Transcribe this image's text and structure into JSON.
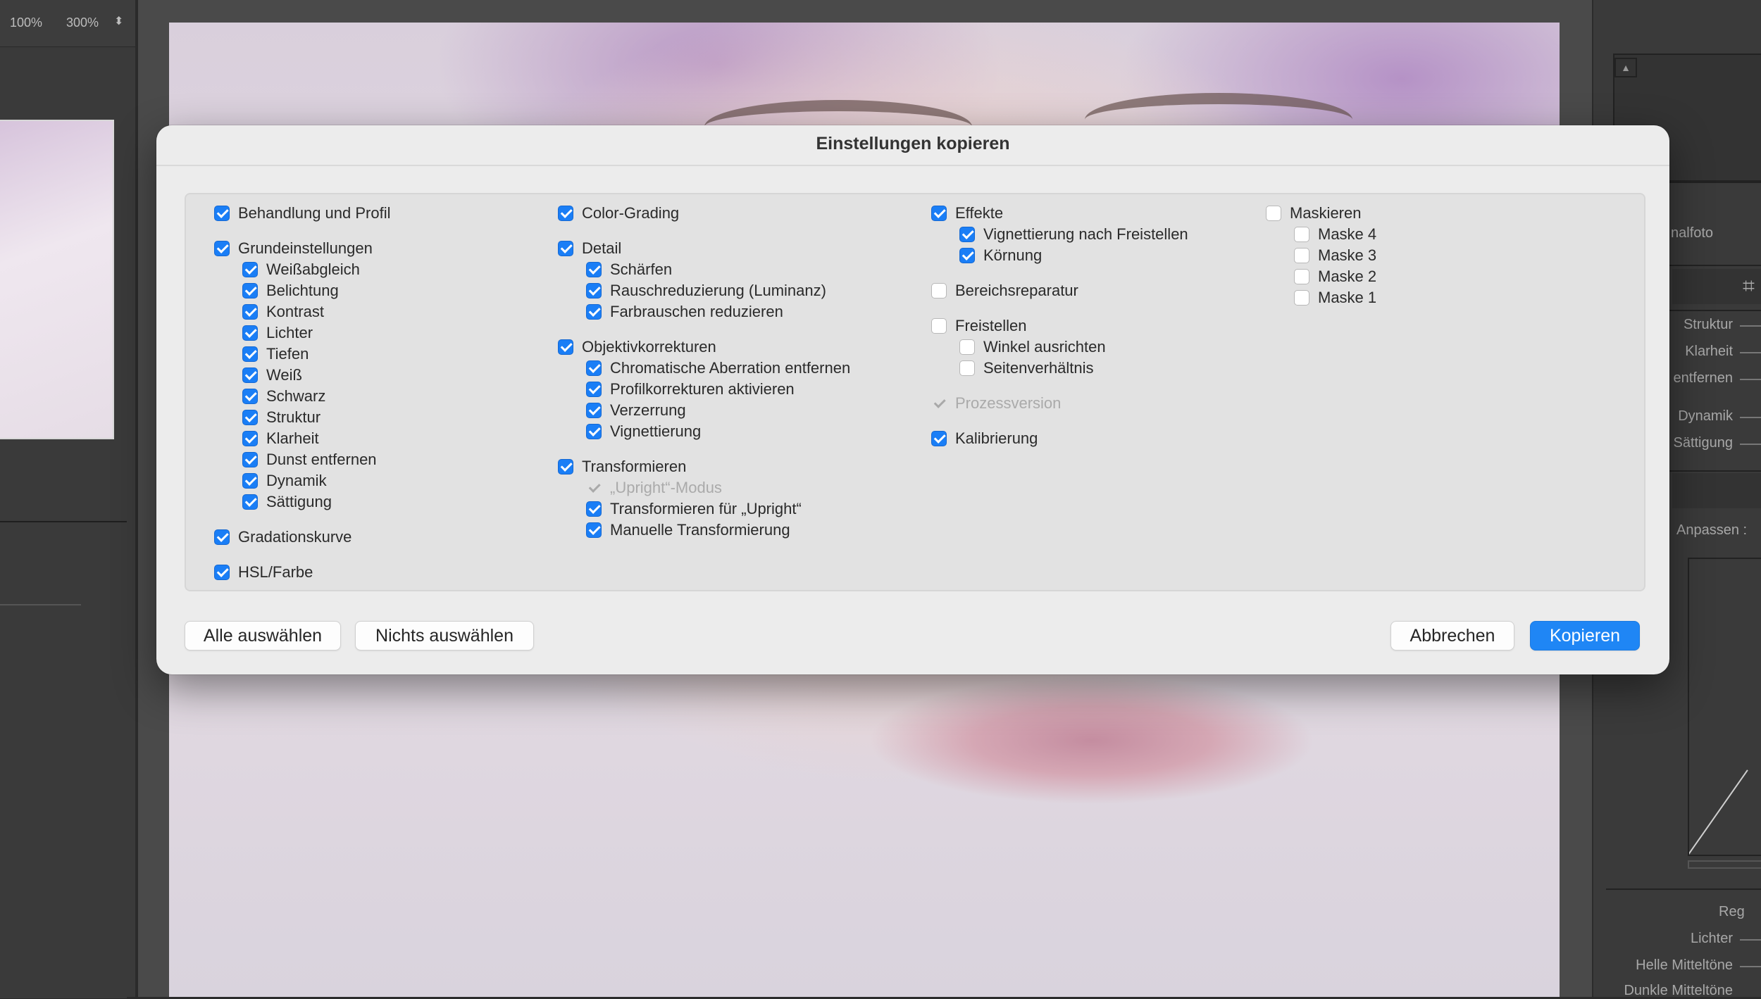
{
  "background": {
    "zoom_options": [
      "100%",
      "300%"
    ],
    "right_panel_labels": {
      "photo_label": "nalfoto",
      "struktur": "Struktur",
      "klarheit": "Klarheit",
      "entfernen": "entfernen",
      "dynamik": "Dynamik",
      "saettigung": "Sättigung",
      "anpassen": "Anpassen :",
      "reg": "Reg",
      "lichter": "Lichter",
      "helle_mitteltoene": "Helle Mitteltöne",
      "dunkle_mitteltoene": "Dunkle Mitteltöne"
    }
  },
  "dialog": {
    "title": "Einstellungen kopieren",
    "columns": [
      {
        "groups": [
          {
            "label": "Behandlung und Profil",
            "state": "checked",
            "children": []
          },
          {
            "label": "Grundeinstellungen",
            "state": "checked",
            "children": [
              {
                "label": "Weißabgleich",
                "state": "checked"
              },
              {
                "label": "Belichtung",
                "state": "checked"
              },
              {
                "label": "Kontrast",
                "state": "checked"
              },
              {
                "label": "Lichter",
                "state": "checked"
              },
              {
                "label": "Tiefen",
                "state": "checked"
              },
              {
                "label": "Weiß",
                "state": "checked"
              },
              {
                "label": "Schwarz",
                "state": "checked"
              },
              {
                "label": "Struktur",
                "state": "checked"
              },
              {
                "label": "Klarheit",
                "state": "checked"
              },
              {
                "label": "Dunst entfernen",
                "state": "checked"
              },
              {
                "label": "Dynamik",
                "state": "checked"
              },
              {
                "label": "Sättigung",
                "state": "checked"
              }
            ]
          },
          {
            "label": "Gradationskurve",
            "state": "checked",
            "children": []
          },
          {
            "label": "HSL/Farbe",
            "state": "checked",
            "children": []
          }
        ]
      },
      {
        "groups": [
          {
            "label": "Color-Grading",
            "state": "checked",
            "children": []
          },
          {
            "label": "Detail",
            "state": "checked",
            "children": [
              {
                "label": "Schärfen",
                "state": "checked"
              },
              {
                "label": "Rauschreduzierung (Luminanz)",
                "state": "checked"
              },
              {
                "label": "Farbrauschen reduzieren",
                "state": "checked"
              }
            ]
          },
          {
            "label": "Objektivkorrekturen",
            "state": "checked",
            "children": [
              {
                "label": "Chromatische Aberration entfernen",
                "state": "checked"
              },
              {
                "label": "Profilkorrekturen aktivieren",
                "state": "checked"
              },
              {
                "label": "Verzerrung",
                "state": "checked"
              },
              {
                "label": "Vignettierung",
                "state": "checked"
              }
            ]
          },
          {
            "label": "Transformieren",
            "state": "checked",
            "children": [
              {
                "label": "„Upright“-Modus",
                "state": "disabled"
              },
              {
                "label": "Transformieren für „Upright“",
                "state": "checked"
              },
              {
                "label": "Manuelle Transformierung",
                "state": "checked"
              }
            ]
          }
        ]
      },
      {
        "groups": [
          {
            "label": "Effekte",
            "state": "checked",
            "children": [
              {
                "label": "Vignettierung nach Freistellen",
                "state": "checked"
              },
              {
                "label": "Körnung",
                "state": "checked"
              }
            ]
          },
          {
            "label": "Bereichsreparatur",
            "state": "unchecked",
            "children": []
          },
          {
            "label": "Freistellen",
            "state": "unchecked",
            "children": [
              {
                "label": "Winkel ausrichten",
                "state": "unchecked"
              },
              {
                "label": "Seitenverhältnis",
                "state": "unchecked"
              }
            ]
          },
          {
            "label": "Prozessversion",
            "state": "disabled",
            "children": []
          },
          {
            "label": "Kalibrierung",
            "state": "checked",
            "children": []
          }
        ]
      },
      {
        "groups": [
          {
            "label": "Maskieren",
            "state": "unchecked",
            "children": [
              {
                "label": "Maske 4",
                "state": "unchecked"
              },
              {
                "label": "Maske 3",
                "state": "unchecked"
              },
              {
                "label": "Maske 2",
                "state": "unchecked"
              },
              {
                "label": "Maske 1",
                "state": "unchecked"
              }
            ]
          }
        ]
      }
    ],
    "buttons": {
      "select_all": "Alle auswählen",
      "select_none": "Nichts auswählen",
      "cancel": "Abbrechen",
      "copy": "Kopieren"
    },
    "accent_color": "#1a7ef6"
  }
}
